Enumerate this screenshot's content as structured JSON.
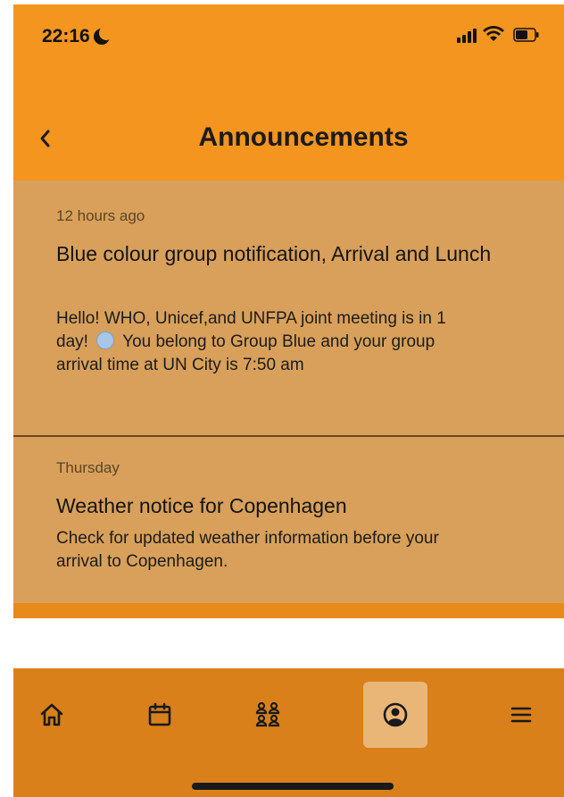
{
  "status_bar": {
    "time": "22:16"
  },
  "header": {
    "title": "Announcements"
  },
  "announcements": [
    {
      "timestamp": "12 hours ago",
      "title": "Blue colour group notification, Arrival and Lunch",
      "body_before_emoji": "Hello! WHO, Unicef,and UNFPA joint meeting is in 1 day!",
      "body_after_emoji": "You belong to Group Blue and your group arrival time at UN City is 7:50 am"
    },
    {
      "timestamp": "Thursday",
      "title": "Weather notice for Copenhagen",
      "body": "Check for updated weather information before your arrival to Copenhagen."
    }
  ],
  "tabbar": {
    "tabs": [
      {
        "icon": "home-icon",
        "active": false
      },
      {
        "icon": "calendar-icon",
        "active": false
      },
      {
        "icon": "groups-icon",
        "active": false
      },
      {
        "icon": "profile-icon",
        "active": true
      },
      {
        "icon": "menu-icon",
        "active": false
      }
    ],
    "accent": "#d9801b",
    "active_bg": "#e9b677"
  },
  "colors": {
    "header_bg": "#f4951f",
    "list_bg": "#d8a05a"
  }
}
